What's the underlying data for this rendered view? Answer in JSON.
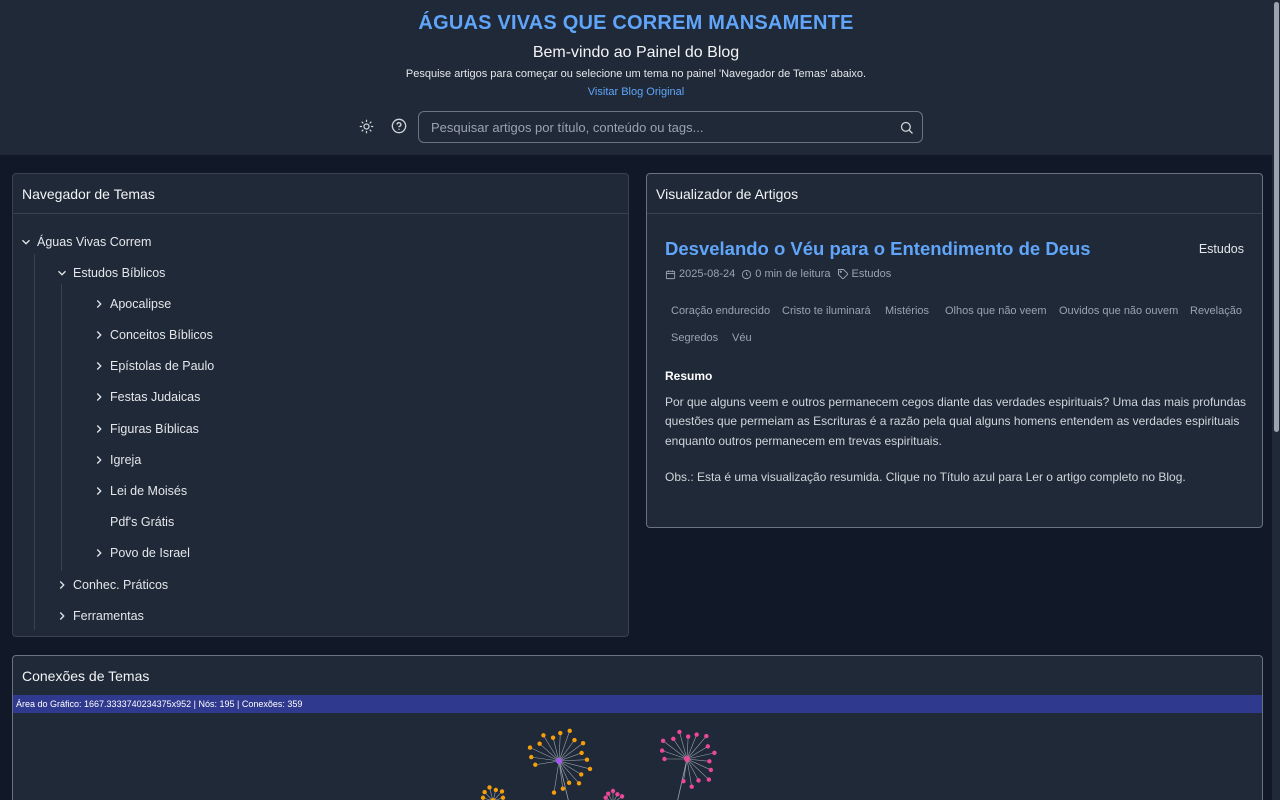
{
  "header": {
    "site_title": "ÁGUAS VIVAS QUE CORREM MANSAMENTE",
    "welcome": "Bem-vindo ao Painel do Blog",
    "intro": "Pesquise artigos para começar ou selecione um tema no painel 'Navegador de Temas' abaixo.",
    "visit_link": "Visitar Blog Original",
    "theme_toggle_icon": "sun-icon",
    "help_icon": "question-circle-icon"
  },
  "search": {
    "placeholder": "Pesquisar artigos por título, conteúdo ou tags...",
    "value": ""
  },
  "topic_navigator": {
    "title": "Navegador de Temas",
    "root": "Águas Vivas Correm",
    "group": "Estudos Bíblicos",
    "children": [
      "Apocalipse",
      "Conceitos Bíblicos",
      "Epístolas de Paulo",
      "Festas Judaicas",
      "Figuras Bíblicas",
      "Igreja",
      "Lei de Moisés",
      "Pdf's Grátis",
      "Povo de Israel"
    ],
    "siblings": [
      "Conhec. Práticos",
      "Ferramentas"
    ]
  },
  "article_viewer": {
    "title": "Visualizador de Artigos",
    "article_title": "Desvelando o Véu para o Entendimento de Deus",
    "category": "Estudos",
    "date": "2025-08-24",
    "read_time": "0 min de leitura",
    "tag_category": "Estudos",
    "tags": [
      "Coração endurecido",
      "Cristo te iluminará",
      "Mistérios",
      "Olhos que não veem",
      "Ouvidos que não ouvem",
      "Revelação",
      "Segredos",
      "Véu"
    ],
    "summary_label": "Resumo",
    "summary": "Por que alguns veem e outros permanecem cegos diante das verdades espirituais? Uma das mais profundas questões que permeiam as Escrituras é a razão pela qual alguns homens entendem as verdades espirituais enquanto outros permanecem em trevas espirituais.",
    "note": "Obs.: Esta é uma visualização resumida. Clique no Título azul para Ler o artigo completo no Blog."
  },
  "connections": {
    "title": "Conexões de Temas",
    "graph_info": "Área do Gráfico: 1667.3333740234375x952 | Nós: 195 | Conexões: 359",
    "node_colors": [
      "#f59e0b",
      "#ec4899",
      "#a855f7"
    ]
  }
}
